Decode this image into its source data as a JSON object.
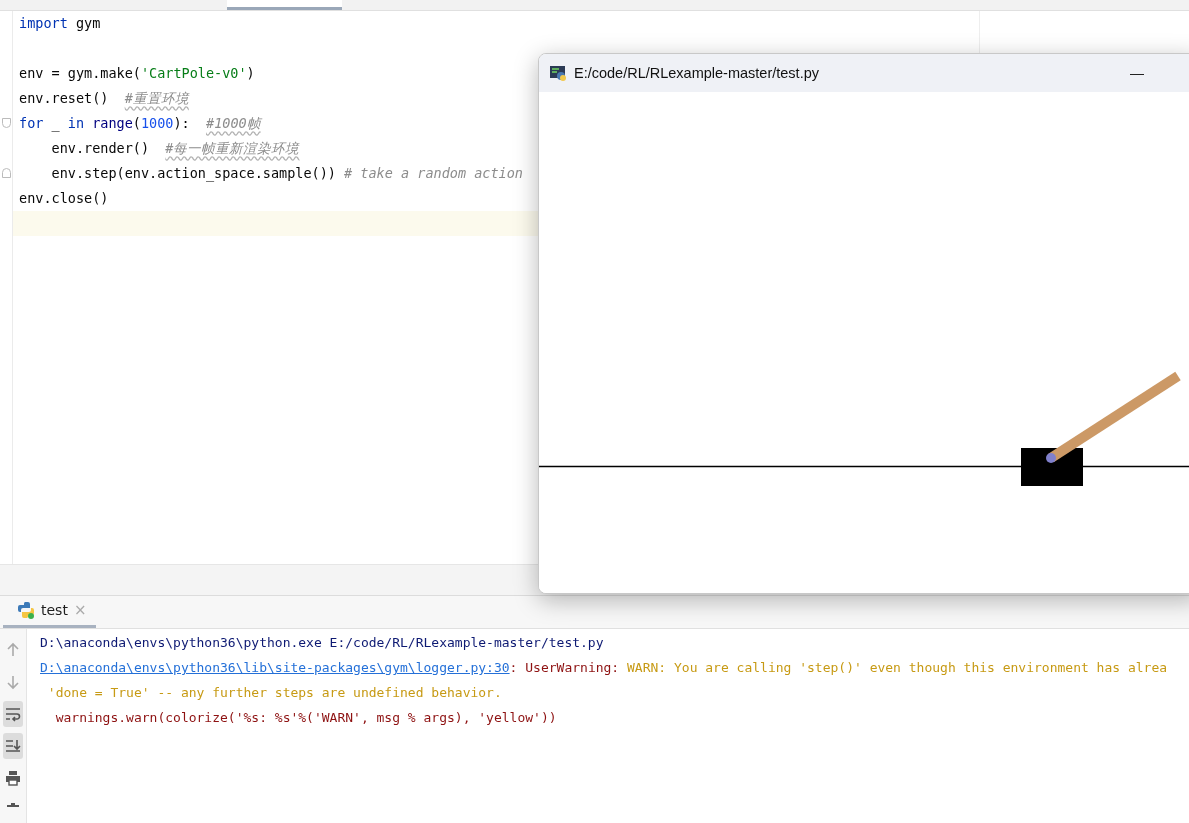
{
  "editor": {
    "lines": [
      {
        "current": false,
        "tokens": [
          {
            "text": "import",
            "kind": "keyword"
          },
          {
            "text": " gym",
            "kind": "plain"
          }
        ]
      },
      {
        "current": false
      },
      {
        "current": false,
        "tokens": [
          {
            "text": "env = gym.make(",
            "kind": "plain"
          },
          {
            "text": "'CartPole-v0'",
            "kind": "string"
          },
          {
            "text": ")",
            "kind": "plain"
          }
        ]
      },
      {
        "current": false,
        "tokens": [
          {
            "text": "env.reset()  ",
            "kind": "plain"
          },
          {
            "text": "#重置环境",
            "kind": "comment",
            "flagged": true
          }
        ]
      },
      {
        "current": false,
        "fold_open": true,
        "tokens": [
          {
            "text": "for",
            "kind": "keyword"
          },
          {
            "text": " _ ",
            "kind": "plain"
          },
          {
            "text": "in",
            "kind": "keyword"
          },
          {
            "text": " range",
            "kind": "builtin"
          },
          {
            "text": "(",
            "kind": "plain"
          },
          {
            "text": "1000",
            "kind": "number"
          },
          {
            "text": "):  ",
            "kind": "plain"
          },
          {
            "text": "#1000帧",
            "kind": "comment",
            "flagged": true
          }
        ]
      },
      {
        "current": false,
        "tokens": [
          {
            "text": "    env.render()  ",
            "kind": "plain"
          },
          {
            "text": "#每一帧重新渲染环境",
            "kind": "comment",
            "flagged": true
          }
        ]
      },
      {
        "current": false,
        "fold_close": true,
        "tokens": [
          {
            "text": "    env.step(env.action_space.sample())",
            "kind": "plain"
          },
          {
            "text": " # take a random action",
            "kind": "comment",
            "flagged": false
          }
        ]
      },
      {
        "current": false,
        "tokens": [
          {
            "text": "env.close()",
            "kind": "plain"
          }
        ]
      },
      {
        "current": true
      }
    ]
  },
  "render_window": {
    "title": "E:/code/RL/RLexample-master/test.py",
    "minimize": "—"
  },
  "run_panel": {
    "tab": {
      "label": "test",
      "close": "×",
      "selected": true
    },
    "toolbar": [
      {
        "kind": "up",
        "on": false
      },
      {
        "kind": "down",
        "on": false
      },
      {
        "kind": "wrap",
        "on": true
      },
      {
        "kind": "scroll-end",
        "on": true
      },
      {
        "kind": "print",
        "on": false
      },
      {
        "kind": "trash",
        "on": false
      }
    ],
    "lines": [
      [
        {
          "text": "D:\\anaconda\\envs\\python36\\python.exe E:/code/RL/RLexample-master/test.py",
          "kind": "command"
        }
      ],
      [
        {
          "text": "D:\\anaconda\\envs\\python36\\lib\\site-packages\\gym\\logger.py:30",
          "kind": "link"
        },
        {
          "text": ": UserWarning: ",
          "kind": "error"
        },
        {
          "text": "WARN: You are calling 'step()' even though this environment has alrea",
          "kind": "warn"
        }
      ],
      [
        {
          "text": " 'done = True' -- any further steps are undefined behavior.",
          "kind": "warn"
        }
      ],
      [
        {
          "text": "  warnings.warn(colorize('%s: %s'%('WARN', msg % args), 'yellow'))",
          "kind": "error"
        }
      ]
    ]
  }
}
